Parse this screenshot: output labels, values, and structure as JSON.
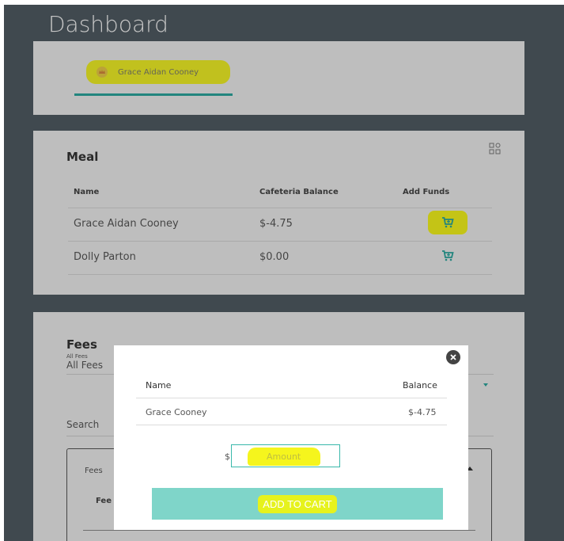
{
  "page": {
    "title": "Dashboard"
  },
  "students_tabs": [
    {
      "label": "Grace Aidan Cooney",
      "icon": "crown-icon"
    }
  ],
  "meal": {
    "title": "Meal",
    "columns": {
      "name": "Name",
      "balance": "Cafeteria Balance",
      "add_funds": "Add Funds"
    },
    "rows": [
      {
        "name": "Grace Aidan Cooney",
        "balance": "$-4.75",
        "icon": "cart-plus-icon"
      },
      {
        "name": "Dolly Parton",
        "balance": "$0.00",
        "icon": "cart-plus-icon"
      }
    ],
    "view_icon": "grid-view-icon"
  },
  "fees": {
    "title": "Fees",
    "filter_label": "All Fees",
    "filter_value": "All Fees",
    "search_label": "Search",
    "section_label": "Fees",
    "section_column": "Fee"
  },
  "modal": {
    "columns": {
      "name": "Name",
      "balance": "Balance"
    },
    "row": {
      "name": "Grace Cooney",
      "balance": "$-4.75"
    },
    "currency_symbol": "$",
    "amount_placeholder": "Amount",
    "submit_label": "ADD TO CART",
    "close_icon": "close-icon"
  },
  "colors": {
    "accent": "#2aa39a",
    "highlight": "#f0f01c",
    "button": "#7fd5c9",
    "background": "#4f5a61"
  }
}
